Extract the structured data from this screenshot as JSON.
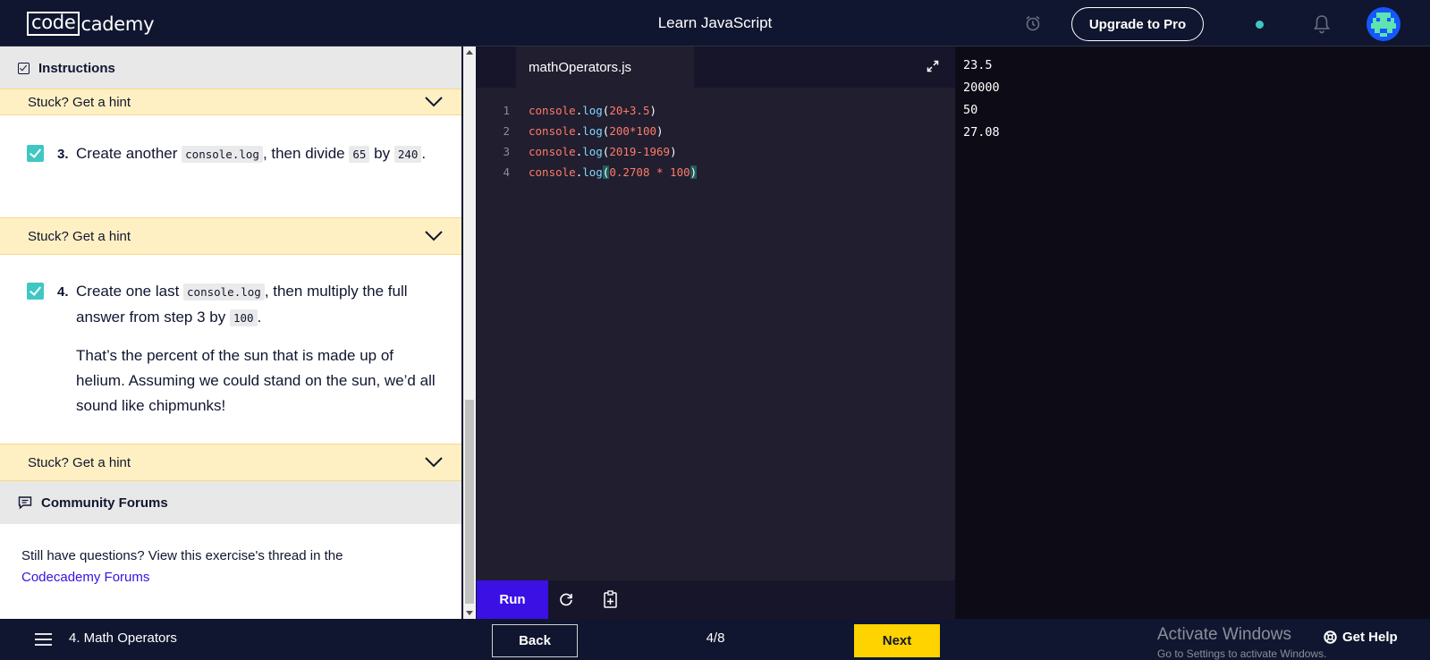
{
  "topbar": {
    "logo_box": "code",
    "logo_rest": "cademy",
    "course_title": "Learn JavaScript",
    "upgrade_label": "Upgrade to Pro",
    "status_dot_color": "#3fc7c4"
  },
  "instructions": {
    "header": "Instructions",
    "hint_label": "Stuck? Get a hint",
    "tasks": [
      {
        "number": "3.",
        "checked": true,
        "parts": [
          "Create another ",
          "console.log",
          ", then divide ",
          "65",
          " by ",
          "240",
          "."
        ]
      },
      {
        "number": "4.",
        "checked": true,
        "parts": [
          "Create one last ",
          "console.log",
          ", then multiply the full answer from step 3 by ",
          "100",
          "."
        ],
        "extra": "That’s the percent of the sun that is made up of helium. Assuming we could stand on the sun, we’d all sound like chipmunks!"
      }
    ]
  },
  "community": {
    "header": "Community Forums",
    "text": "Still have questions? View this exercise's thread in the",
    "link": "Codecademy Forums"
  },
  "editor": {
    "filename": "mathOperators.js",
    "lines": [
      {
        "n": "1",
        "obj": "console",
        "fn": "log",
        "args": "20+3.5"
      },
      {
        "n": "2",
        "obj": "console",
        "fn": "log",
        "args": "200*100"
      },
      {
        "n": "3",
        "obj": "console",
        "fn": "log",
        "args": "2019-1969"
      },
      {
        "n": "4",
        "obj": "console",
        "fn": "log",
        "args": "0.2708 * 100"
      }
    ],
    "run_label": "Run"
  },
  "output": {
    "lines": [
      "23.5",
      "20000",
      "50",
      "27.08"
    ]
  },
  "bottombar": {
    "lesson": "4. Math Operators",
    "back_label": "Back",
    "progress": "4/8",
    "next_label": "Next",
    "activate_title": "Activate Windows",
    "activate_sub": "Go to Settings to activate Windows.",
    "help_label": "Get Help"
  },
  "colors": {
    "accent": "#3a10e5",
    "check": "#3fc7c4",
    "hint_bg": "#fff0c3",
    "next": "#ffd300"
  }
}
